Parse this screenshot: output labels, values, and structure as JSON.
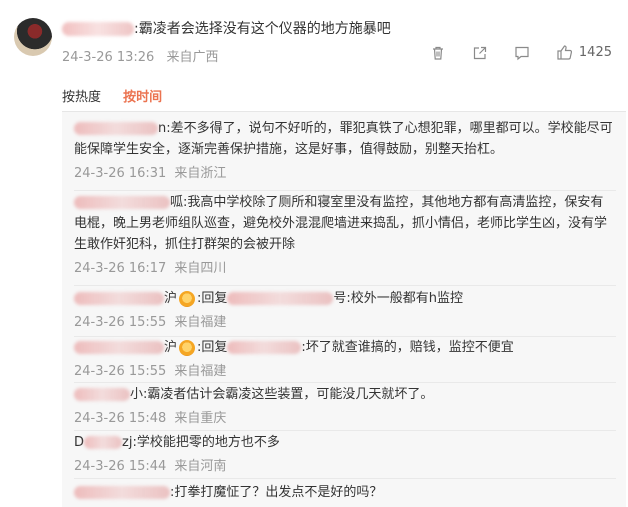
{
  "comment": {
    "text": ":霸凌者会选择没有这个仪器的地方施暴吧",
    "date": "24-3-26 13:26",
    "location": "来自广西",
    "like_count": "1425"
  },
  "sort": {
    "hot": "按热度",
    "time": "按时间"
  },
  "replies": [
    {
      "text": "n:差不多得了，说句不好听的，罪犯真铁了心想犯罪，哪里都可以。学校能尽可能保障学生安全，逐渐完善保护措施，这是好事，值得鼓励，别整天抬杠。",
      "date": "24-3-26 16:31",
      "location": "来自浙江"
    },
    {
      "text": "呱:我高中学校除了厕所和寝室里没有监控，其他地方都有高清监控，保安有电棍，晚上男老师组队巡查，避免校外混混爬墙进来捣乱，抓小情侣，老师比学生凶，没有学生敢作奸犯科，抓住打群架的会被开除",
      "date": "24-3-26 16:17",
      "location": "来自四川"
    },
    {
      "text_a": "沪",
      "text_b": ":回复",
      "text_c": "号:校外一般都有h监控",
      "date": "24-3-26 15:55",
      "location": "来自福建"
    },
    {
      "text_a": "沪",
      "text_b": ":回复",
      "text_c": ":坏了就查谁搞的，赔钱，监控不便宜",
      "date": "24-3-26 15:55",
      "location": "来自福建"
    },
    {
      "text": "小:霸凌者估计会霸凌这些装置，可能没几天就坏了。",
      "date": "24-3-26 15:48",
      "location": "来自重庆"
    },
    {
      "text_a": "D",
      "text_b": "zj:学校能把零的地方也不多",
      "date": "24-3-26 15:44",
      "location": "来自河南"
    },
    {
      "text": ":打拳打魔怔了？出发点不是好的吗？"
    }
  ],
  "colors": {
    "accent": "#eb7350",
    "muted": "#999999",
    "panel_bg": "#f7f7f7"
  },
  "icons": [
    "trash-icon",
    "share-icon",
    "comment-icon",
    "like-icon",
    "vip-badge-icon"
  ]
}
